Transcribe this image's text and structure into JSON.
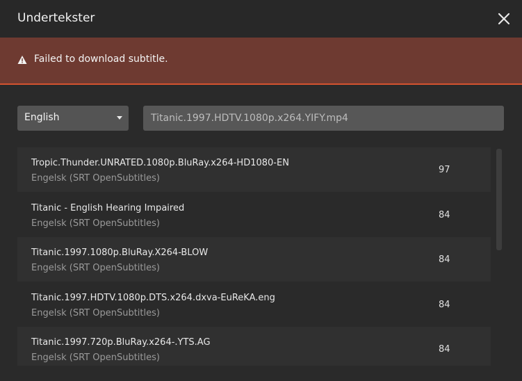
{
  "dialog": {
    "title": "Undertekster",
    "close_icon": "close-icon"
  },
  "error": {
    "icon": "warning-icon",
    "message": "Failed to download subtitle."
  },
  "controls": {
    "language": "English",
    "query": "Titanic.1997.HDTV.1080p.x264.YIFY.mp4"
  },
  "results": [
    {
      "name": "Tropic.Thunder.UNRATED.1080p.BluRay.x264-HD1080-EN",
      "source": "Engelsk (SRT OpenSubtitles)",
      "score": "97"
    },
    {
      "name": "Titanic - English Hearing Impaired",
      "source": "Engelsk (SRT OpenSubtitles)",
      "score": "84"
    },
    {
      "name": "Titanic.1997.1080p.BluRay.X264-BLOW",
      "source": "Engelsk (SRT OpenSubtitles)",
      "score": "84"
    },
    {
      "name": "Titanic.1997.HDTV.1080p.DTS.x264.dxva-EuReKA.eng",
      "source": "Engelsk (SRT OpenSubtitles)",
      "score": "84"
    },
    {
      "name": "Titanic.1997.720p.BluRay.x264-.YTS.AG",
      "source": "Engelsk (SRT OpenSubtitles)",
      "score": "84"
    }
  ],
  "colors": {
    "background": "#282828",
    "error_bg": "#6e3a31",
    "error_border": "#d4532f"
  }
}
